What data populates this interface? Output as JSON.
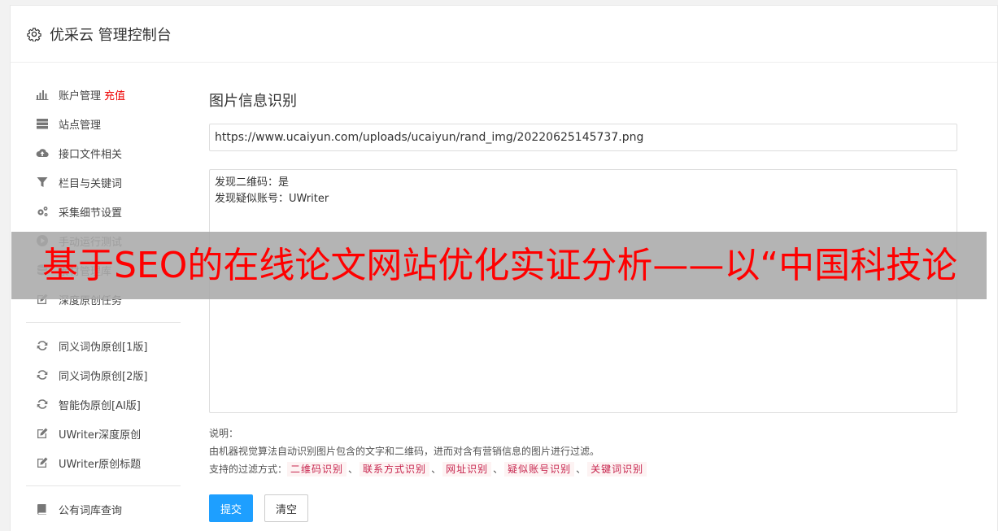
{
  "header": {
    "title": "优采云 管理控制台",
    "icon": "gear-icon"
  },
  "sidebar": {
    "group1": [
      {
        "icon": "bar-chart-icon",
        "label": "账户管理",
        "extra": "充值"
      },
      {
        "icon": "server-icon",
        "label": "站点管理"
      },
      {
        "icon": "cloud-upload-icon",
        "label": "接口文件相关"
      },
      {
        "icon": "filter-icon",
        "label": "栏目与关键词"
      },
      {
        "icon": "cogs-icon",
        "label": "采集细节设置"
      },
      {
        "icon": "play-circle-icon",
        "label": "手动运行测试"
      },
      {
        "icon": "database-icon",
        "label": "素材管理库"
      },
      {
        "icon": "edit-icon",
        "label": "深度原创任务"
      }
    ],
    "group2": [
      {
        "icon": "refresh-icon",
        "label": "同义词伪原创[1版]"
      },
      {
        "icon": "refresh-icon",
        "label": "同义词伪原创[2版]"
      },
      {
        "icon": "refresh-icon",
        "label": "智能伪原创[AI版]"
      },
      {
        "icon": "edit-icon",
        "label": "UWriter深度原创"
      },
      {
        "icon": "edit-icon",
        "label": "UWriter原创标题"
      }
    ],
    "group3": [
      {
        "icon": "book-icon",
        "label": "公有词库查询"
      }
    ]
  },
  "main": {
    "title": "图片信息识别",
    "url_value": "https://www.ucaiyun.com/uploads/ucaiyun/rand_img/20220625145737.png",
    "result_lines": [
      "发现二维码：是",
      "发现疑似账号：UWriter"
    ],
    "notes_label": "说明：",
    "notes_desc": "由机器视觉算法自动识别图片包含的文字和二维码，进而对含有营销信息的图片进行过滤。",
    "filter_prefix": "支持的过滤方式：",
    "filter_tags": [
      "二维码识别",
      "联系方式识别",
      "网址识别",
      "疑似账号识别",
      "关键词识别"
    ],
    "filter_sep": "、",
    "submit_label": "提交",
    "clear_label": "清空"
  },
  "overlay": {
    "text": "基于SEO的在线论文网站优化实证分析——以“中国科技论"
  },
  "colors": {
    "primary": "#1e9fff",
    "recharge": "#ee0000",
    "overlay_text": "#ff0000",
    "tag_text": "#c7254e"
  }
}
